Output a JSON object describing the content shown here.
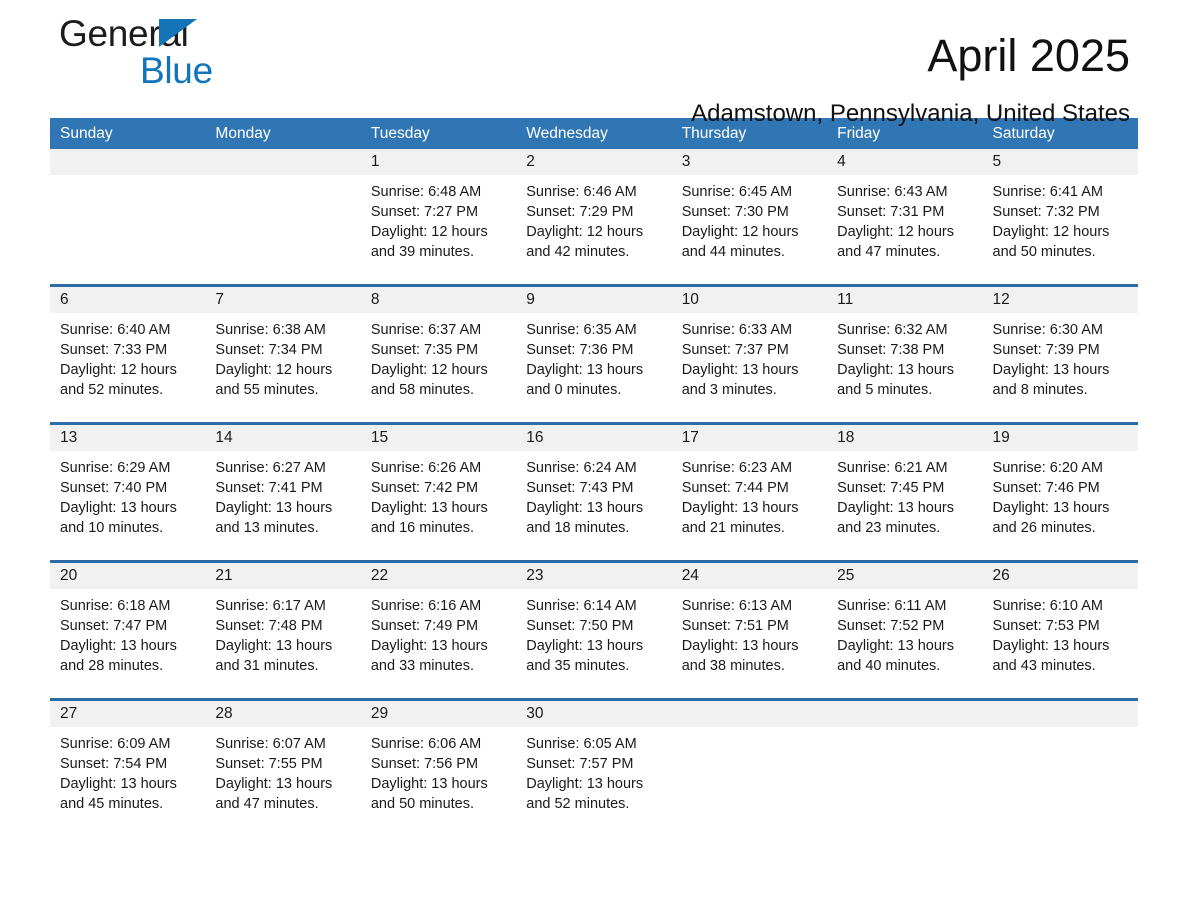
{
  "logo": {
    "word1": "General",
    "word2": "Blue",
    "triangle_color": "#1574b8",
    "blue_text_color": "#0f75bc"
  },
  "header": {
    "month_title": "April 2025",
    "location": "Adamstown, Pennsylvania, United States"
  },
  "calendar": {
    "header_bg": "#3076b4",
    "row_divider": "#2b6ca8",
    "date_band_bg": "#f1f1f1",
    "weekdays": [
      "Sunday",
      "Monday",
      "Tuesday",
      "Wednesday",
      "Thursday",
      "Friday",
      "Saturday"
    ],
    "weeks": [
      [
        {
          "day": "",
          "lines": []
        },
        {
          "day": "",
          "lines": []
        },
        {
          "day": "1",
          "lines": [
            "Sunrise: 6:48 AM",
            "Sunset: 7:27 PM",
            "Daylight: 12 hours",
            "and 39 minutes."
          ]
        },
        {
          "day": "2",
          "lines": [
            "Sunrise: 6:46 AM",
            "Sunset: 7:29 PM",
            "Daylight: 12 hours",
            "and 42 minutes."
          ]
        },
        {
          "day": "3",
          "lines": [
            "Sunrise: 6:45 AM",
            "Sunset: 7:30 PM",
            "Daylight: 12 hours",
            "and 44 minutes."
          ]
        },
        {
          "day": "4",
          "lines": [
            "Sunrise: 6:43 AM",
            "Sunset: 7:31 PM",
            "Daylight: 12 hours",
            "and 47 minutes."
          ]
        },
        {
          "day": "5",
          "lines": [
            "Sunrise: 6:41 AM",
            "Sunset: 7:32 PM",
            "Daylight: 12 hours",
            "and 50 minutes."
          ]
        }
      ],
      [
        {
          "day": "6",
          "lines": [
            "Sunrise: 6:40 AM",
            "Sunset: 7:33 PM",
            "Daylight: 12 hours",
            "and 52 minutes."
          ]
        },
        {
          "day": "7",
          "lines": [
            "Sunrise: 6:38 AM",
            "Sunset: 7:34 PM",
            "Daylight: 12 hours",
            "and 55 minutes."
          ]
        },
        {
          "day": "8",
          "lines": [
            "Sunrise: 6:37 AM",
            "Sunset: 7:35 PM",
            "Daylight: 12 hours",
            "and 58 minutes."
          ]
        },
        {
          "day": "9",
          "lines": [
            "Sunrise: 6:35 AM",
            "Sunset: 7:36 PM",
            "Daylight: 13 hours",
            "and 0 minutes."
          ]
        },
        {
          "day": "10",
          "lines": [
            "Sunrise: 6:33 AM",
            "Sunset: 7:37 PM",
            "Daylight: 13 hours",
            "and 3 minutes."
          ]
        },
        {
          "day": "11",
          "lines": [
            "Sunrise: 6:32 AM",
            "Sunset: 7:38 PM",
            "Daylight: 13 hours",
            "and 5 minutes."
          ]
        },
        {
          "day": "12",
          "lines": [
            "Sunrise: 6:30 AM",
            "Sunset: 7:39 PM",
            "Daylight: 13 hours",
            "and 8 minutes."
          ]
        }
      ],
      [
        {
          "day": "13",
          "lines": [
            "Sunrise: 6:29 AM",
            "Sunset: 7:40 PM",
            "Daylight: 13 hours",
            "and 10 minutes."
          ]
        },
        {
          "day": "14",
          "lines": [
            "Sunrise: 6:27 AM",
            "Sunset: 7:41 PM",
            "Daylight: 13 hours",
            "and 13 minutes."
          ]
        },
        {
          "day": "15",
          "lines": [
            "Sunrise: 6:26 AM",
            "Sunset: 7:42 PM",
            "Daylight: 13 hours",
            "and 16 minutes."
          ]
        },
        {
          "day": "16",
          "lines": [
            "Sunrise: 6:24 AM",
            "Sunset: 7:43 PM",
            "Daylight: 13 hours",
            "and 18 minutes."
          ]
        },
        {
          "day": "17",
          "lines": [
            "Sunrise: 6:23 AM",
            "Sunset: 7:44 PM",
            "Daylight: 13 hours",
            "and 21 minutes."
          ]
        },
        {
          "day": "18",
          "lines": [
            "Sunrise: 6:21 AM",
            "Sunset: 7:45 PM",
            "Daylight: 13 hours",
            "and 23 minutes."
          ]
        },
        {
          "day": "19",
          "lines": [
            "Sunrise: 6:20 AM",
            "Sunset: 7:46 PM",
            "Daylight: 13 hours",
            "and 26 minutes."
          ]
        }
      ],
      [
        {
          "day": "20",
          "lines": [
            "Sunrise: 6:18 AM",
            "Sunset: 7:47 PM",
            "Daylight: 13 hours",
            "and 28 minutes."
          ]
        },
        {
          "day": "21",
          "lines": [
            "Sunrise: 6:17 AM",
            "Sunset: 7:48 PM",
            "Daylight: 13 hours",
            "and 31 minutes."
          ]
        },
        {
          "day": "22",
          "lines": [
            "Sunrise: 6:16 AM",
            "Sunset: 7:49 PM",
            "Daylight: 13 hours",
            "and 33 minutes."
          ]
        },
        {
          "day": "23",
          "lines": [
            "Sunrise: 6:14 AM",
            "Sunset: 7:50 PM",
            "Daylight: 13 hours",
            "and 35 minutes."
          ]
        },
        {
          "day": "24",
          "lines": [
            "Sunrise: 6:13 AM",
            "Sunset: 7:51 PM",
            "Daylight: 13 hours",
            "and 38 minutes."
          ]
        },
        {
          "day": "25",
          "lines": [
            "Sunrise: 6:11 AM",
            "Sunset: 7:52 PM",
            "Daylight: 13 hours",
            "and 40 minutes."
          ]
        },
        {
          "day": "26",
          "lines": [
            "Sunrise: 6:10 AM",
            "Sunset: 7:53 PM",
            "Daylight: 13 hours",
            "and 43 minutes."
          ]
        }
      ],
      [
        {
          "day": "27",
          "lines": [
            "Sunrise: 6:09 AM",
            "Sunset: 7:54 PM",
            "Daylight: 13 hours",
            "and 45 minutes."
          ]
        },
        {
          "day": "28",
          "lines": [
            "Sunrise: 6:07 AM",
            "Sunset: 7:55 PM",
            "Daylight: 13 hours",
            "and 47 minutes."
          ]
        },
        {
          "day": "29",
          "lines": [
            "Sunrise: 6:06 AM",
            "Sunset: 7:56 PM",
            "Daylight: 13 hours",
            "and 50 minutes."
          ]
        },
        {
          "day": "30",
          "lines": [
            "Sunrise: 6:05 AM",
            "Sunset: 7:57 PM",
            "Daylight: 13 hours",
            "and 52 minutes."
          ]
        },
        {
          "day": "",
          "lines": []
        },
        {
          "day": "",
          "lines": []
        },
        {
          "day": "",
          "lines": []
        }
      ]
    ]
  }
}
